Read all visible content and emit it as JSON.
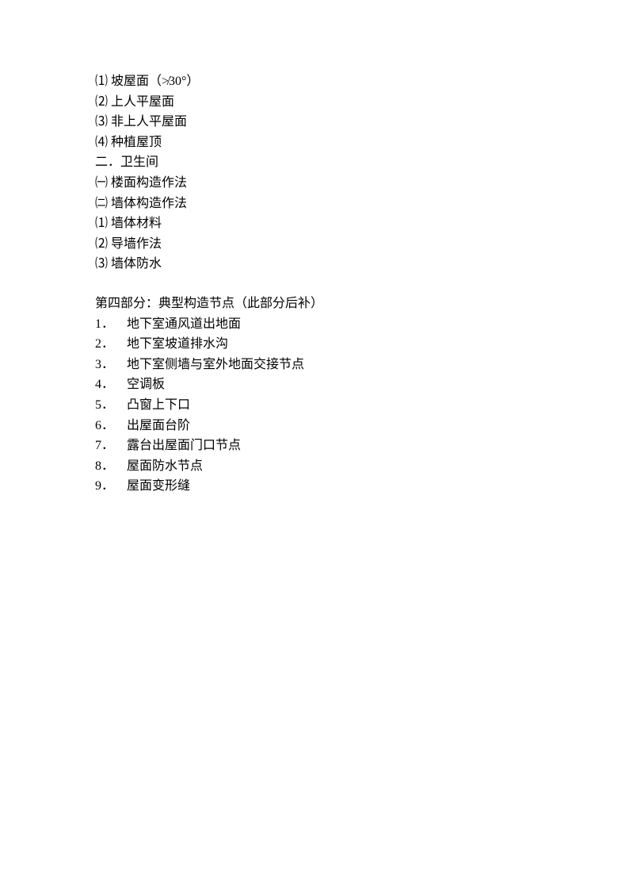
{
  "section1": {
    "items": [
      "⑴ 坡屋面（≯30°）",
      "⑵ 上人平屋面",
      "⑶ 非上人平屋面",
      "⑷ 种植屋顶",
      "二．卫生间",
      "㈠ 楼面构造作法",
      "㈡ 墙体构造作法",
      "⑴ 墙体材料",
      "⑵ 导墙作法",
      "⑶ 墙体防水"
    ]
  },
  "section2": {
    "title": "第四部分：典型构造节点（此部分后补）",
    "items": [
      {
        "num": "1．",
        "text": "地下室通风道出地面"
      },
      {
        "num": "2．",
        "text": "地下室坡道排水沟"
      },
      {
        "num": "3．",
        "text": "地下室侧墙与室外地面交接节点"
      },
      {
        "num": "4．",
        "text": "空调板"
      },
      {
        "num": "5．",
        "text": "凸窗上下口"
      },
      {
        "num": "6．",
        "text": "出屋面台阶"
      },
      {
        "num": "7．",
        "text": "露台出屋面门口节点"
      },
      {
        "num": "8．",
        "text": "屋面防水节点"
      },
      {
        "num": "9．",
        "text": "屋面变形缝"
      }
    ]
  }
}
